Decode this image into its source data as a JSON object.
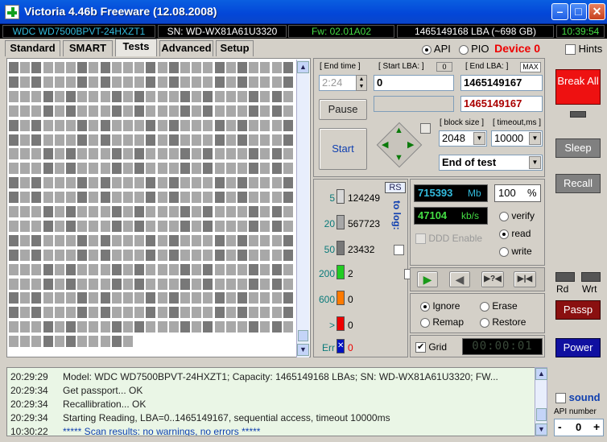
{
  "window": {
    "title": "Victoria 4.46b Freeware (12.08.2008)"
  },
  "info": {
    "model": "WDC WD7500BPVT-24HXZT1",
    "serial": "SN: WD-WX81A61U3320",
    "firmware": "Fw: 02.01A02",
    "lba": "1465149168 LBA (~698 GB)",
    "clock": "10:39:54"
  },
  "tabs": [
    "Standard",
    "SMART",
    "Tests",
    "Advanced",
    "Setup"
  ],
  "iface": {
    "api": "API",
    "pio": "PIO",
    "device": "Device 0",
    "hints": "Hints"
  },
  "test": {
    "end_time_label": "[ End time ]",
    "end_time": "2:24",
    "start_lba_label": "[ Start LBA: ]",
    "start_lba_reset": "0",
    "start_lba": "0",
    "end_lba_label": "[ End LBA: ]",
    "end_lba_max": "MAX",
    "end_lba": "1465149167",
    "current_lba": "1465149167",
    "pause": "Pause",
    "start": "Start",
    "block_size_label": "[ block size ]",
    "block_size": "2048",
    "timeout_label": "[ timeout,ms ]",
    "timeout": "10000",
    "end_action": "End of test"
  },
  "latency": {
    "rs": "RS",
    "to_log": "to log:",
    "rows": [
      {
        "ms": "5",
        "count": "124249",
        "color": "#d8d8d8",
        "logged": false
      },
      {
        "ms": "20",
        "count": "567723",
        "color": "#a8a8a8",
        "logged": false
      },
      {
        "ms": "50",
        "count": "23432",
        "color": "#787878",
        "logged": false
      },
      {
        "ms": "200",
        "count": "2",
        "color": "#22cc22",
        "logged": false
      },
      {
        "ms": "600",
        "count": "0",
        "color": "#ff7a00",
        "logged": true
      },
      {
        "ms": ">",
        "count": "0",
        "color": "#ee0000",
        "logged": true
      },
      {
        "ms": "Err",
        "count": "0",
        "color": "#0010c0",
        "logged": true
      }
    ]
  },
  "progress": {
    "mb": "715393",
    "mb_unit": "Mb",
    "percent": "100",
    "percent_unit": "%",
    "speed": "47104",
    "speed_unit": "kb/s",
    "ddd": "DDD Enable"
  },
  "mode": {
    "verify": "verify",
    "read": "read",
    "write": "write",
    "selected": "read"
  },
  "action": {
    "ignore": "Ignore",
    "erase": "Erase",
    "remap": "Remap",
    "restore": "Restore",
    "selected": "Ignore",
    "grid": "Grid",
    "timer": "00:00:01"
  },
  "side": {
    "break": "Break All",
    "sleep": "Sleep",
    "recall": "Recall",
    "rd": "Rd",
    "wrt": "Wrt",
    "passp": "Passp",
    "power": "Power",
    "sound": "sound",
    "api_number_label": "API number",
    "api_number": "0"
  },
  "log": [
    {
      "time": "20:29:29",
      "text": "Model: WDC WD7500BPVT-24HXZT1; Capacity: 1465149168 LBAs; SN: WD-WX81A61U3320; FW..."
    },
    {
      "time": "20:29:34",
      "text": "Get passport... OK"
    },
    {
      "time": "20:29:34",
      "text": "Recallibration... OK"
    },
    {
      "time": "20:29:34",
      "text": "Starting Reading, LBA=0..1465149167, sequential access, timeout 10000ms"
    },
    {
      "time": "10:30:22",
      "text": "***** Scan results: no warnings, no errors *****"
    }
  ]
}
